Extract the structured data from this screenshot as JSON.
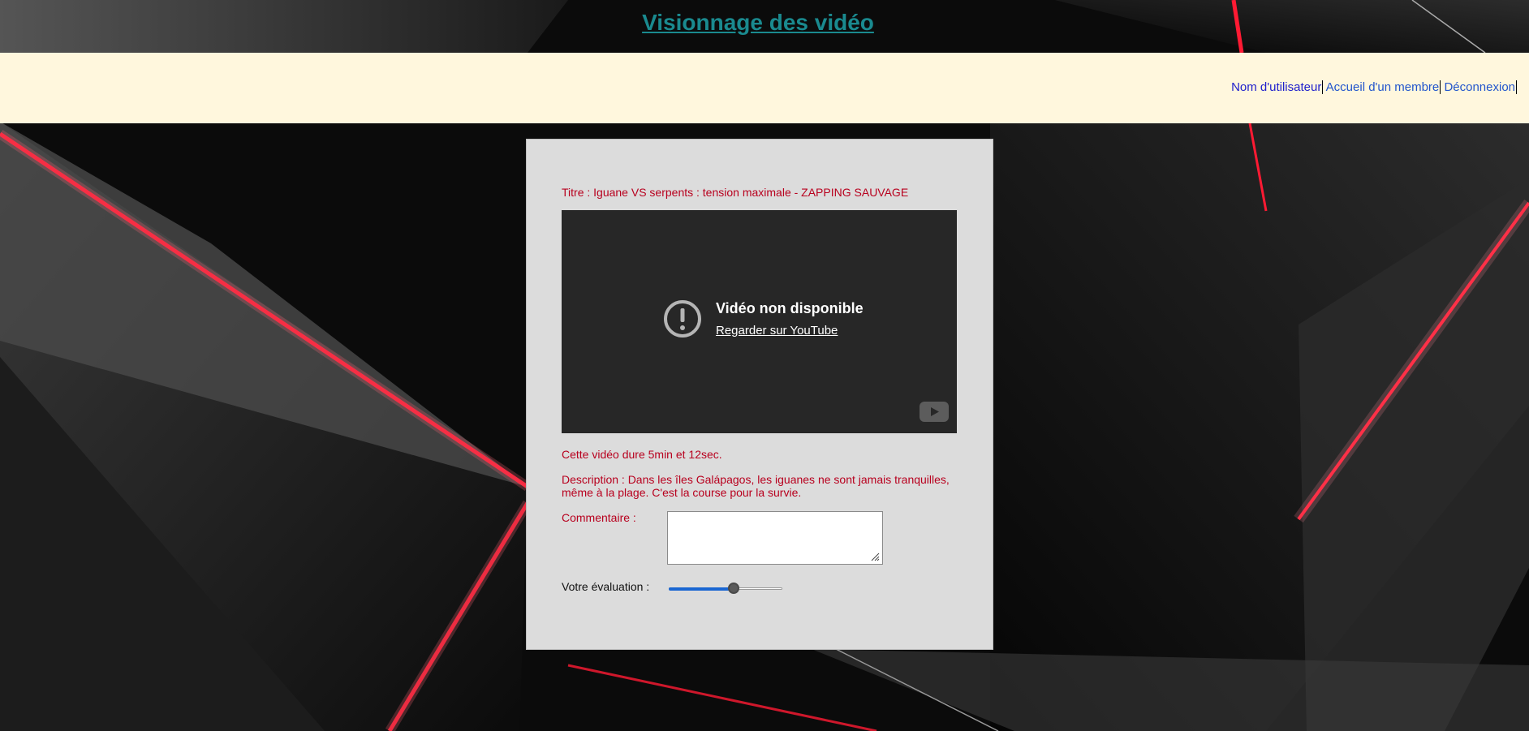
{
  "header": {
    "title": "Visionnage des vidéo"
  },
  "nav": {
    "username": "Nom d'utilisateur",
    "member_home": "Accueil d'un membre",
    "logout": "Déconnexion"
  },
  "video": {
    "title_line": "Titre : Iguane VS serpents : tension maximale - ZAPPING SAUVAGE",
    "unavailable_title": "Vidéo non disponible",
    "watch_link": "Regarder sur YouTube",
    "duration_line": "Cette vidéo dure 5min et 12sec.",
    "description_line": "Description : Dans les îles Galápagos, les iguanes ne sont jamais tranquilles, même à la plage. C'est la course pour la survie."
  },
  "comment": {
    "label": "Commentaire :",
    "value": ""
  },
  "rating": {
    "label": "Votre évaluation :",
    "value_fraction": 0.58
  },
  "colors": {
    "title_link": "#1a8a8f",
    "navbar_bg": "#fff7dd",
    "panel_bg": "#dcdcdc",
    "red_text": "#b8001e",
    "slider_fill": "#1a66d2"
  },
  "icons": {
    "unavailable": "exclamation-circle-icon",
    "youtube": "youtube-logo-icon",
    "resize": "resize-grip-icon"
  }
}
